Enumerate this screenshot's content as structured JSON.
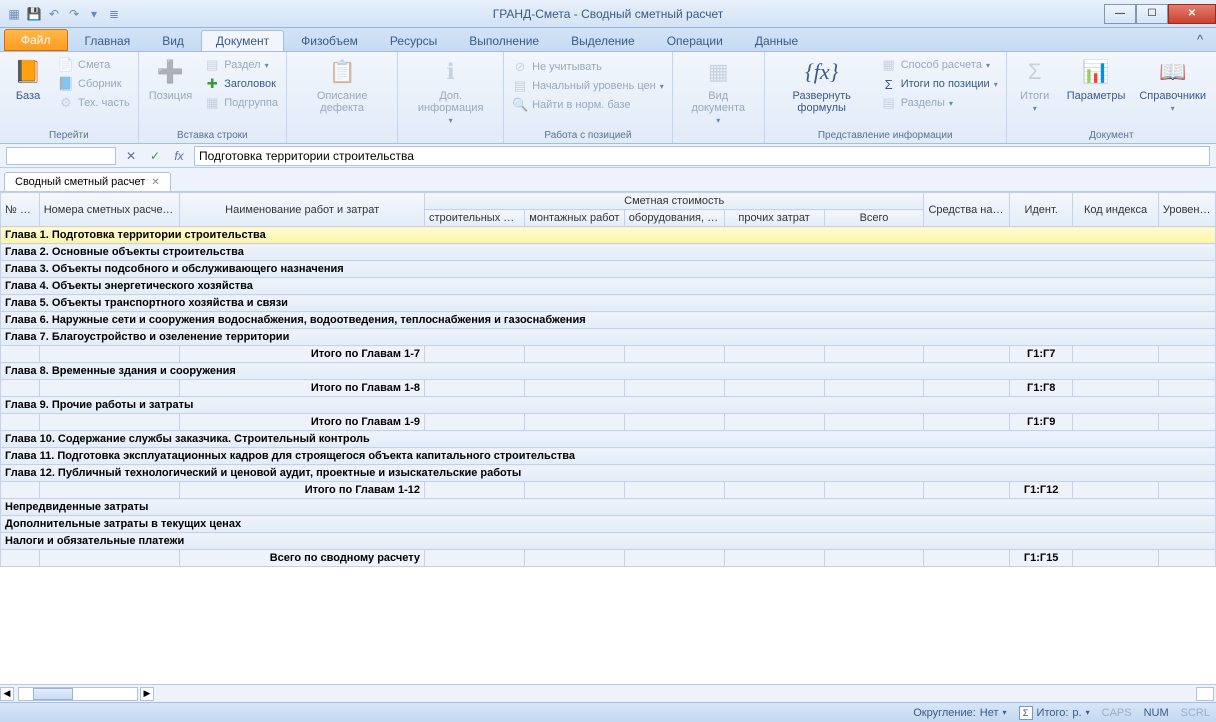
{
  "window": {
    "title": "ГРАНД-Смета - Сводный сметный расчет"
  },
  "tabs": {
    "file": "Файл",
    "items": [
      "Главная",
      "Вид",
      "Документ",
      "Физобъем",
      "Ресурсы",
      "Выполнение",
      "Выделение",
      "Операции",
      "Данные"
    ],
    "active_index": 2
  },
  "ribbon": {
    "groups": {
      "go": {
        "label": "Перейти",
        "base": "База",
        "smeta": "Смета",
        "sbornik": "Сборник",
        "tech": "Тех. часть"
      },
      "insert": {
        "label": "Вставка строки",
        "position": "Позиция",
        "razdel": "Раздел",
        "header": "Заголовок",
        "subgroup": "Подгруппа"
      },
      "defect": {
        "label": "",
        "desc": "Описание дефекта"
      },
      "info": {
        "label": "",
        "info": "Доп. информация"
      },
      "work": {
        "label": "Работа с позицией",
        "skip": "Не учитывать",
        "level": "Начальный уровень цен",
        "norm": "Найти в норм. базе"
      },
      "view": {
        "label": "",
        "doc": "Вид документа"
      },
      "present": {
        "label": "Представление информации",
        "formula": "Развернуть формулы",
        "calc": "Способ расчета",
        "itogi_pos": "Итоги по позиции",
        "razdely": "Разделы"
      },
      "docgrp": {
        "label": "Документ",
        "itogi": "Итоги",
        "params": "Параметры",
        "sprav": "Справочники"
      }
    }
  },
  "formula_bar": {
    "value": "Подготовка территории строительства",
    "fx": "fx"
  },
  "sheet_tab": "Сводный сметный расчет",
  "headers": {
    "num": "№ п.п",
    "estnums": "Номера сметных расчетов и смет",
    "name": "Наименование работ и затрат",
    "cost_group": "Сметная стоимость",
    "build": "строительных работ",
    "montage": "монтажных работ",
    "equip": "оборудования, мебели, инвентаря",
    "other": "прочих затрат",
    "total": "Всего",
    "wage": "Средства на оплату труда",
    "ident": "Идент.",
    "index": "Код индекса",
    "level": "Уровень цен"
  },
  "rows": [
    {
      "type": "chapter",
      "sel": true,
      "text": "Глава 1. Подготовка территории строительства"
    },
    {
      "type": "chapter",
      "text": "Глава 2. Основные объекты строительства"
    },
    {
      "type": "chapter",
      "text": "Глава 3. Объекты подсобного и обслуживающего назначения"
    },
    {
      "type": "chapter",
      "text": "Глава 4. Объекты энергетического хозяйства"
    },
    {
      "type": "chapter",
      "text": "Глава 5. Объекты транспортного хозяйства и связи"
    },
    {
      "type": "chapter",
      "text": "Глава 6. Наружные сети и сооружения водоснабжения, водоотведения, теплоснабжения и газоснабжения"
    },
    {
      "type": "chapter",
      "text": "Глава 7. Благоустройство и озеленение территории"
    },
    {
      "type": "total",
      "text": "Итого по Главам 1-7",
      "ident": "Г1:Г7"
    },
    {
      "type": "chapter",
      "text": "Глава 8. Временные здания и сооружения"
    },
    {
      "type": "total",
      "text": "Итого по Главам 1-8",
      "ident": "Г1:Г8"
    },
    {
      "type": "chapter",
      "text": "Глава 9. Прочие работы и затраты"
    },
    {
      "type": "total",
      "text": "Итого по Главам 1-9",
      "ident": "Г1:Г9"
    },
    {
      "type": "chapter",
      "text": "Глава 10. Содержание службы заказчика. Строительный контроль"
    },
    {
      "type": "chapter",
      "text": "Глава 11. Подготовка эксплуатационных кадров для строящегося объекта капитального строительства"
    },
    {
      "type": "chapter",
      "text": "Глава 12. Публичный технологический и ценовой аудит, проектные и изыскательские работы"
    },
    {
      "type": "total",
      "text": "Итого по Главам 1-12",
      "ident": "Г1:Г12"
    },
    {
      "type": "chapter",
      "text": "Непредвиденные затраты"
    },
    {
      "type": "chapter",
      "text": "Дополнительные затраты в текущих ценах"
    },
    {
      "type": "chapter",
      "text": "Налоги и обязательные платежи"
    },
    {
      "type": "grand",
      "text": "Всего по сводному расчету",
      "ident": "Г1:Г15"
    }
  ],
  "status": {
    "rounding_label": "Округление:",
    "rounding_value": "Нет",
    "itogo_label": "Итого:",
    "itogo_value": "р.",
    "caps": "CAPS",
    "num": "NUM",
    "scrl": "SCRL"
  }
}
